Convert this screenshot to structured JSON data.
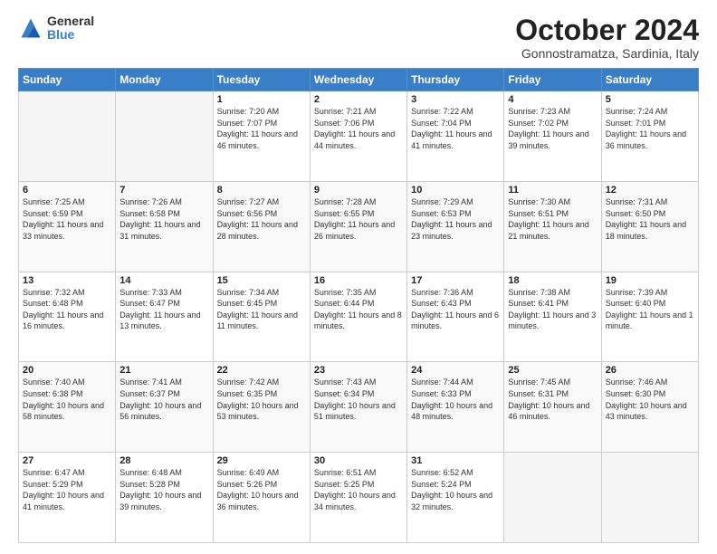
{
  "logo": {
    "general": "General",
    "blue": "Blue"
  },
  "header": {
    "month": "October 2024",
    "location": "Gonnostramatza, Sardinia, Italy"
  },
  "weekdays": [
    "Sunday",
    "Monday",
    "Tuesday",
    "Wednesday",
    "Thursday",
    "Friday",
    "Saturday"
  ],
  "weeks": [
    [
      {
        "day": "",
        "empty": true
      },
      {
        "day": "",
        "empty": true
      },
      {
        "day": "1",
        "sunrise": "7:20 AM",
        "sunset": "7:07 PM",
        "daylight": "11 hours and 46 minutes."
      },
      {
        "day": "2",
        "sunrise": "7:21 AM",
        "sunset": "7:06 PM",
        "daylight": "11 hours and 44 minutes."
      },
      {
        "day": "3",
        "sunrise": "7:22 AM",
        "sunset": "7:04 PM",
        "daylight": "11 hours and 41 minutes."
      },
      {
        "day": "4",
        "sunrise": "7:23 AM",
        "sunset": "7:02 PM",
        "daylight": "11 hours and 39 minutes."
      },
      {
        "day": "5",
        "sunrise": "7:24 AM",
        "sunset": "7:01 PM",
        "daylight": "11 hours and 36 minutes."
      }
    ],
    [
      {
        "day": "6",
        "sunrise": "7:25 AM",
        "sunset": "6:59 PM",
        "daylight": "11 hours and 33 minutes."
      },
      {
        "day": "7",
        "sunrise": "7:26 AM",
        "sunset": "6:58 PM",
        "daylight": "11 hours and 31 minutes."
      },
      {
        "day": "8",
        "sunrise": "7:27 AM",
        "sunset": "6:56 PM",
        "daylight": "11 hours and 28 minutes."
      },
      {
        "day": "9",
        "sunrise": "7:28 AM",
        "sunset": "6:55 PM",
        "daylight": "11 hours and 26 minutes."
      },
      {
        "day": "10",
        "sunrise": "7:29 AM",
        "sunset": "6:53 PM",
        "daylight": "11 hours and 23 minutes."
      },
      {
        "day": "11",
        "sunrise": "7:30 AM",
        "sunset": "6:51 PM",
        "daylight": "11 hours and 21 minutes."
      },
      {
        "day": "12",
        "sunrise": "7:31 AM",
        "sunset": "6:50 PM",
        "daylight": "11 hours and 18 minutes."
      }
    ],
    [
      {
        "day": "13",
        "sunrise": "7:32 AM",
        "sunset": "6:48 PM",
        "daylight": "11 hours and 16 minutes."
      },
      {
        "day": "14",
        "sunrise": "7:33 AM",
        "sunset": "6:47 PM",
        "daylight": "11 hours and 13 minutes."
      },
      {
        "day": "15",
        "sunrise": "7:34 AM",
        "sunset": "6:45 PM",
        "daylight": "11 hours and 11 minutes."
      },
      {
        "day": "16",
        "sunrise": "7:35 AM",
        "sunset": "6:44 PM",
        "daylight": "11 hours and 8 minutes."
      },
      {
        "day": "17",
        "sunrise": "7:36 AM",
        "sunset": "6:43 PM",
        "daylight": "11 hours and 6 minutes."
      },
      {
        "day": "18",
        "sunrise": "7:38 AM",
        "sunset": "6:41 PM",
        "daylight": "11 hours and 3 minutes."
      },
      {
        "day": "19",
        "sunrise": "7:39 AM",
        "sunset": "6:40 PM",
        "daylight": "11 hours and 1 minute."
      }
    ],
    [
      {
        "day": "20",
        "sunrise": "7:40 AM",
        "sunset": "6:38 PM",
        "daylight": "10 hours and 58 minutes."
      },
      {
        "day": "21",
        "sunrise": "7:41 AM",
        "sunset": "6:37 PM",
        "daylight": "10 hours and 56 minutes."
      },
      {
        "day": "22",
        "sunrise": "7:42 AM",
        "sunset": "6:35 PM",
        "daylight": "10 hours and 53 minutes."
      },
      {
        "day": "23",
        "sunrise": "7:43 AM",
        "sunset": "6:34 PM",
        "daylight": "10 hours and 51 minutes."
      },
      {
        "day": "24",
        "sunrise": "7:44 AM",
        "sunset": "6:33 PM",
        "daylight": "10 hours and 48 minutes."
      },
      {
        "day": "25",
        "sunrise": "7:45 AM",
        "sunset": "6:31 PM",
        "daylight": "10 hours and 46 minutes."
      },
      {
        "day": "26",
        "sunrise": "7:46 AM",
        "sunset": "6:30 PM",
        "daylight": "10 hours and 43 minutes."
      }
    ],
    [
      {
        "day": "27",
        "sunrise": "6:47 AM",
        "sunset": "5:29 PM",
        "daylight": "10 hours and 41 minutes."
      },
      {
        "day": "28",
        "sunrise": "6:48 AM",
        "sunset": "5:28 PM",
        "daylight": "10 hours and 39 minutes."
      },
      {
        "day": "29",
        "sunrise": "6:49 AM",
        "sunset": "5:26 PM",
        "daylight": "10 hours and 36 minutes."
      },
      {
        "day": "30",
        "sunrise": "6:51 AM",
        "sunset": "5:25 PM",
        "daylight": "10 hours and 34 minutes."
      },
      {
        "day": "31",
        "sunrise": "6:52 AM",
        "sunset": "5:24 PM",
        "daylight": "10 hours and 32 minutes."
      },
      {
        "day": "",
        "empty": true
      },
      {
        "day": "",
        "empty": true
      }
    ]
  ]
}
